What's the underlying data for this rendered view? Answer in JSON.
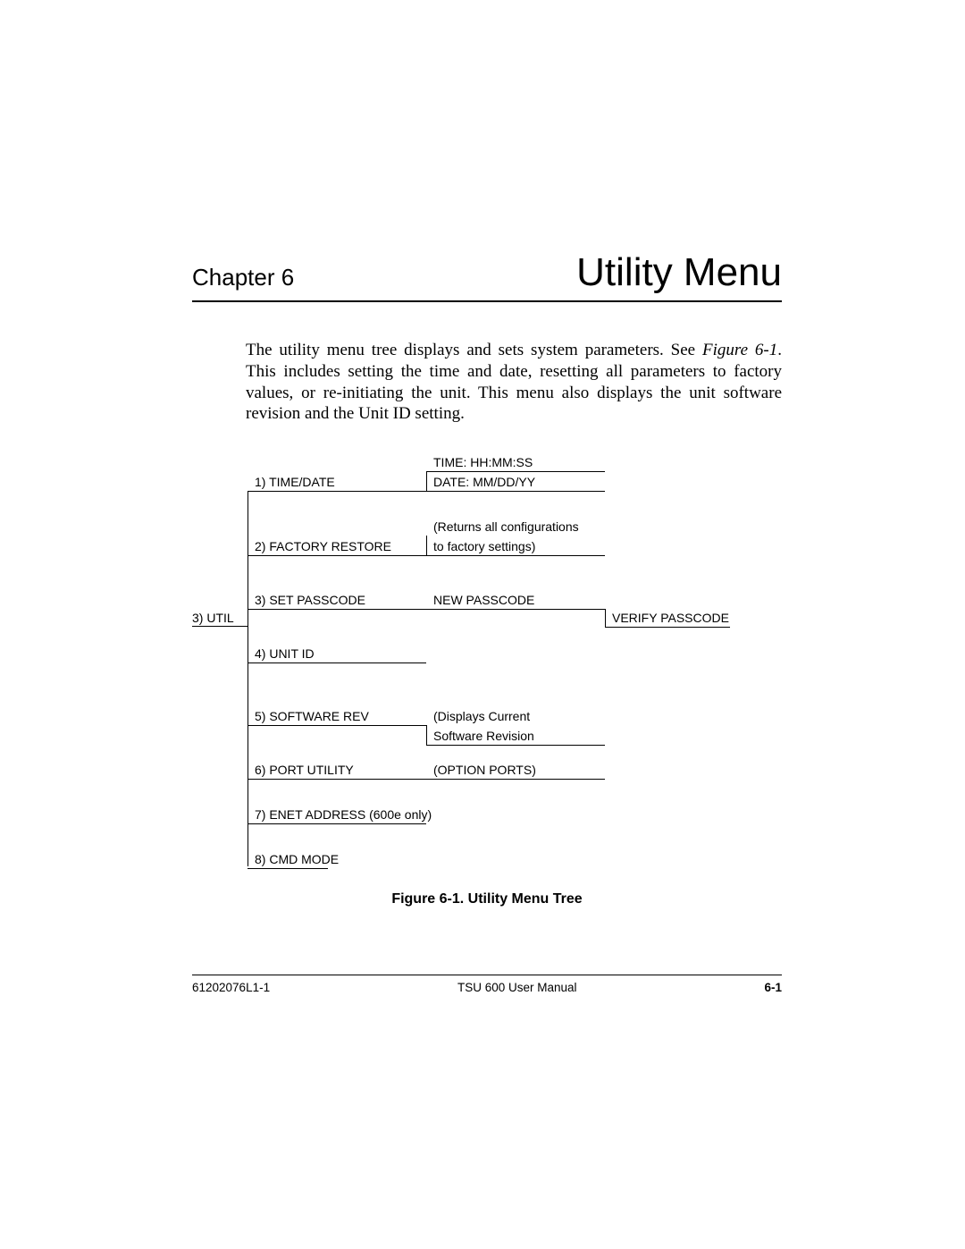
{
  "header": {
    "chapter": "Chapter 6",
    "title": "Utility Menu"
  },
  "body": {
    "p1_a": "The utility menu tree displays and sets system parameters. See ",
    "fig_ref": "Figure 6-1",
    "p1_b": ". This includes setting the time and date, resetting all parameters to factory values, or  re-initiating the unit.  This menu also displays the unit software revision and the Unit ID setting."
  },
  "tree": {
    "root": "3) UTIL",
    "items": [
      "1) TIME/DATE",
      "2) FACTORY RESTORE",
      "3) SET PASSCODE",
      "4) UNIT ID",
      "5) SOFTWARE REV",
      "6) PORT UTILITY",
      "7)  ENET ADDRESS (600e only)",
      "8)  CMD MODE"
    ],
    "col2": {
      "time": "TIME: HH:MM:SS",
      "date": "DATE: MM/DD/YY",
      "factory1": "(Returns all configurations",
      "factory2": "to factory settings)",
      "newpass": "NEW PASSCODE",
      "soft1": "(Displays Current",
      "soft2": "Software Revision",
      "ports": "(OPTION PORTS)"
    },
    "col3": {
      "verify": "VERIFY PASSCODE"
    }
  },
  "figure_caption": "Figure 6-1.  Utility Menu Tree",
  "footer": {
    "left": "61202076L1-1",
    "center": "TSU 600 User Manual",
    "right": "6-1"
  }
}
